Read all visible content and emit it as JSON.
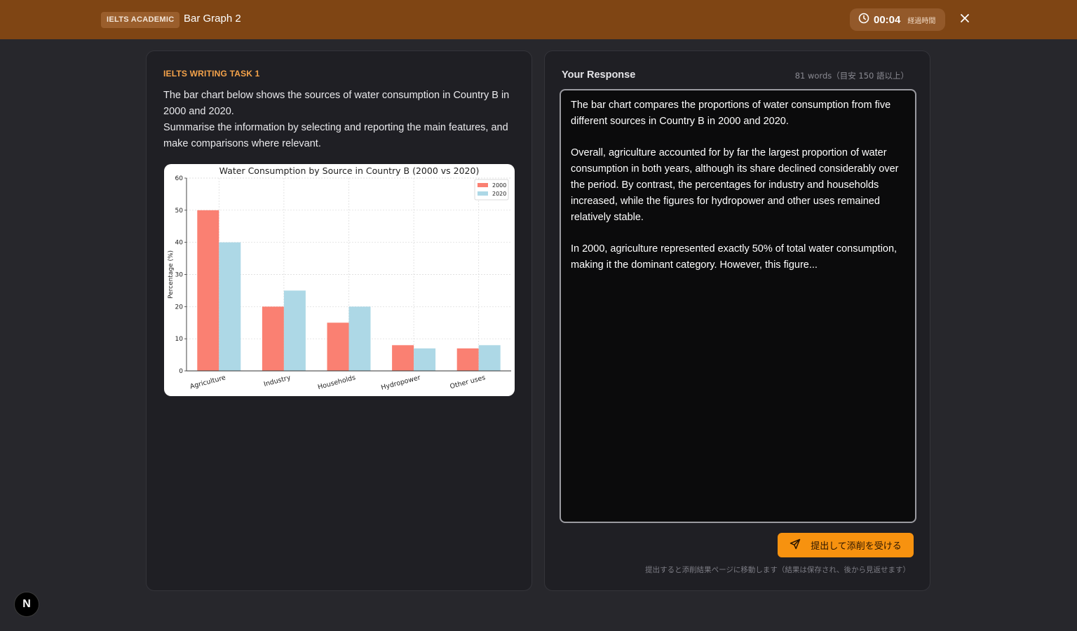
{
  "header": {
    "badge": "IELTS ACADEMIC",
    "title": "Bar Graph 2",
    "timer": "00:04",
    "timer_label": "経過時間"
  },
  "task": {
    "label": "IELTS WRITING TASK 1",
    "prompt_line1": "The bar chart below shows the sources of water consumption in Country B in 2000 and 2020.",
    "prompt_line2": "Summarise the information by selecting and reporting the main features, and make comparisons where relevant."
  },
  "chart_data": {
    "type": "bar",
    "title": "Water Consumption by Source in Country B (2000 vs 2020)",
    "xlabel": "",
    "ylabel": "Percentage (%)",
    "ylim": [
      0,
      60
    ],
    "yticks": [
      0,
      10,
      20,
      30,
      40,
      50,
      60
    ],
    "categories": [
      "Agriculture",
      "Industry",
      "Households",
      "Hydropower",
      "Other uses"
    ],
    "series": [
      {
        "name": "2000",
        "values": [
          50,
          20,
          15,
          8,
          7
        ],
        "color": "#fa8072"
      },
      {
        "name": "2020",
        "values": [
          40,
          25,
          20,
          7,
          8
        ],
        "color": "#add8e6"
      }
    ],
    "grid": true,
    "legend": "top-right"
  },
  "response": {
    "title": "Your Response",
    "word_count": "81 words（目安 150 語以上）",
    "text": "The bar chart compares the proportions of water consumption from five different sources in Country B in 2000 and 2020.\n\nOverall, agriculture accounted for by far the largest proportion of water consumption in both years, although its share declined considerably over the period. By contrast, the percentages for industry and households increased, while the figures for hydropower and other uses remained relatively stable.\n\nIn 2000, agriculture represented exactly 50% of total water consumption, making it the dominant category. However, this figure..."
  },
  "submit": {
    "label": "提出して添削を受ける",
    "hint": "提出すると添削結果ページに移動します（結果は保存され、後から見返せます）"
  },
  "footer": {
    "badge_letter": "N"
  },
  "colors": {
    "header_bg": "#7f4514",
    "accent": "#f7920f",
    "task_label": "#f5a34a"
  }
}
